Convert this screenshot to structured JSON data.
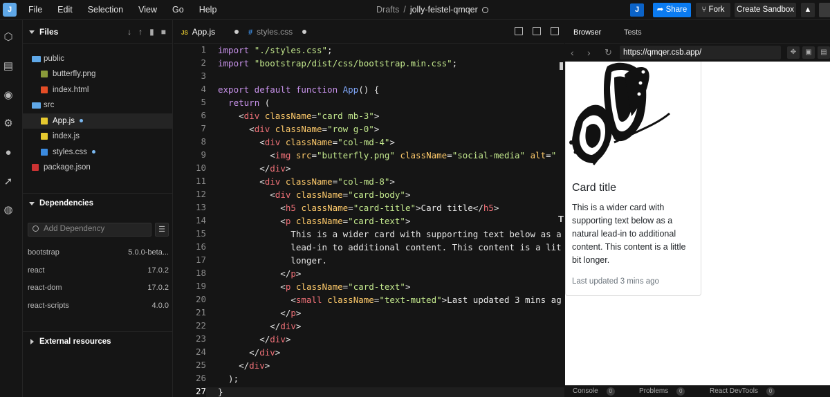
{
  "app": {
    "logo": "J"
  },
  "menu": [
    "File",
    "Edit",
    "Selection",
    "View",
    "Go",
    "Help"
  ],
  "breadcrumb": {
    "root": "Drafts",
    "separator": "/",
    "sandbox": "jolly-feistel-qmqer"
  },
  "header": {
    "avatar": "J",
    "share": "Share",
    "fork": "Fork",
    "create": "Create Sandbox"
  },
  "sidebar": {
    "title": "Files",
    "files": [
      {
        "label": "public",
        "type": "folder"
      },
      {
        "label": "butterfly.png",
        "type": "png"
      },
      {
        "label": "index.html",
        "type": "html"
      },
      {
        "label": "src",
        "type": "folder"
      },
      {
        "label": "App.js",
        "type": "js"
      },
      {
        "label": "index.js",
        "type": "js"
      },
      {
        "label": "styles.css",
        "type": "css"
      },
      {
        "label": "package.json",
        "type": "pkg"
      }
    ],
    "dependencies_title": "Dependencies",
    "dep_placeholder": "Add Dependency",
    "dependencies": [
      {
        "name": "bootstrap",
        "version": "5.0.0-beta..."
      },
      {
        "name": "react",
        "version": "17.0.2"
      },
      {
        "name": "react-dom",
        "version": "17.0.2"
      },
      {
        "name": "react-scripts",
        "version": "4.0.0"
      }
    ],
    "external_title": "External resources"
  },
  "editor": {
    "tabs": [
      {
        "label": "App.js",
        "icon": "JS"
      },
      {
        "label": "styles.css",
        "icon": "#"
      }
    ],
    "line_numbers": [
      "1",
      "2",
      "3",
      "4",
      "5",
      "6",
      "7",
      "8",
      "9",
      "10",
      "11",
      "12",
      "13",
      "14",
      "15",
      "16",
      "17",
      "18",
      "19",
      "20",
      "21",
      "22",
      "23",
      "24",
      "25",
      "26",
      "27"
    ],
    "current_line": "27"
  },
  "browser": {
    "tabs": [
      "Browser",
      "Tests"
    ],
    "url": "https://qmqer.csb.app/",
    "card": {
      "title": "Card title",
      "text": "This is a wider card with supporting text below as a natural lead-in to additional content. This content is a little bit longer.",
      "muted": "Last updated 3 mins ago"
    },
    "footer": [
      {
        "label": "Console",
        "count": "0"
      },
      {
        "label": "Problems",
        "count": "0"
      },
      {
        "label": "React DevTools",
        "count": "0"
      }
    ]
  }
}
